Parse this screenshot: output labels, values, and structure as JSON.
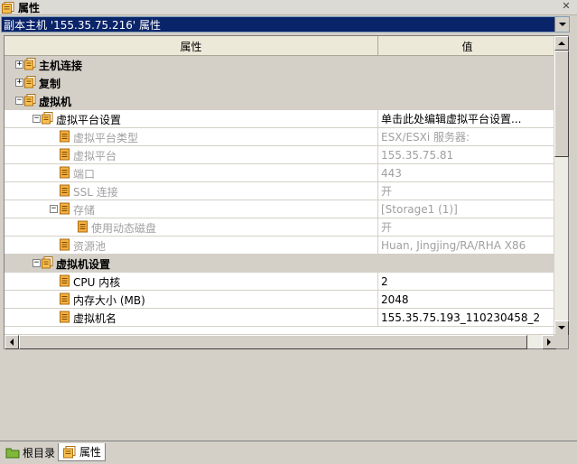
{
  "window": {
    "title": "属性",
    "close_icon": "close-icon"
  },
  "selector": {
    "value": "副本主机 '155.35.75.216' 属性"
  },
  "grid": {
    "columns": {
      "property": "属性",
      "value": "值"
    },
    "rows": [
      {
        "label": "主机连接",
        "value": "",
        "type": "category",
        "toggle": "+"
      },
      {
        "label": "复制",
        "value": "",
        "type": "category",
        "toggle": "+"
      },
      {
        "label": "虚拟机",
        "value": "",
        "type": "category",
        "toggle": "−"
      },
      {
        "label": "虚拟平台设置",
        "value": "单击此处编辑虚拟平台设置...",
        "type": "group",
        "toggle": "−"
      },
      {
        "label": "虚拟平台类型",
        "value": "ESX/ESXi 服务器:",
        "type": "disabled",
        "toggle": ""
      },
      {
        "label": "虚拟平台",
        "value": "155.35.75.81",
        "type": "disabled",
        "toggle": ""
      },
      {
        "label": "端口",
        "value": "443",
        "type": "disabled",
        "toggle": ""
      },
      {
        "label": "SSL 连接",
        "value": "开",
        "type": "disabled",
        "toggle": ""
      },
      {
        "label": "存储",
        "value": "[Storage1 (1)]",
        "type": "disabled",
        "toggle": "−"
      },
      {
        "label": "使用动态磁盘",
        "value": "开",
        "type": "disabled",
        "toggle": ""
      },
      {
        "label": "资源池",
        "value": "Huan, Jingjing/RA/RHA X86",
        "type": "disabled",
        "toggle": ""
      },
      {
        "label": "虚拟机设置",
        "value": "",
        "type": "category",
        "toggle": "−"
      },
      {
        "label": "CPU 内核",
        "value": "2",
        "type": "normal",
        "toggle": ""
      },
      {
        "label": "内存大小 (MB)",
        "value": "2048",
        "type": "normal",
        "toggle": ""
      },
      {
        "label": "虚拟机名",
        "value": "155.35.75.193_110230458_2",
        "type": "normal",
        "toggle": ""
      }
    ]
  },
  "tabs": [
    {
      "label": "根目录",
      "icon": "folder-icon",
      "active": false
    },
    {
      "label": "属性",
      "icon": "properties-icon",
      "active": true
    }
  ],
  "colors": {
    "selection": "#0a246a",
    "category_bg": "#d4d0c8",
    "disabled_text": "#a0a0a0",
    "icon_orange": "#e8a030"
  }
}
